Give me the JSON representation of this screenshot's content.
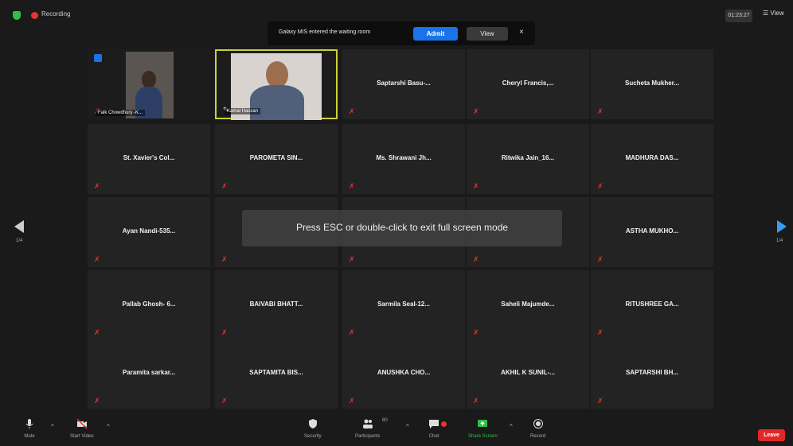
{
  "status": {
    "recording_label": "Recording",
    "timer": "01:23:27",
    "view_label": "View"
  },
  "notice": {
    "text": "Galaxy MIS entered the waiting room",
    "admit_label": "Admit",
    "view_label": "View",
    "close_glyph": "×"
  },
  "toast": {
    "text": "Press ESC or double-click to exit full screen mode"
  },
  "pager": {
    "left": "1/4",
    "right": "1/4"
  },
  "video_tiles": [
    {
      "caption": "Falk Chowdhury -K..."
    },
    {
      "caption": "Kamal Hassan"
    }
  ],
  "participants": [
    "Saptarshi Basu-...",
    "Cheryl Francis,...",
    "Sucheta Mukher...",
    "St. Xavier's Col...",
    "PAROMETA SIN...",
    "Ms. Shrawani Jh...",
    "Ritwika Jain_16...",
    "MADHURA DAS...",
    "Ayan Nandi-535...",
    "ASTHA MUKHO...",
    "Pallab Ghosh- 6...",
    "BAIVABI BHATT...",
    "Sarmila Seal-12...",
    "Saheli Majumde...",
    "RITUSHREE GA...",
    "Paramita sarkar...",
    "SAPTAMITA BIS...",
    "ANUSHKA CHO...",
    "AKHIL K SUNIL-...",
    "SAPTARSHI BH..."
  ],
  "toolbar": {
    "mute": "Mute",
    "start_video": "Start Video",
    "security": "Security",
    "participants": "Participants",
    "participants_count": "80",
    "chat": "Chat",
    "share_screen": "Share Screen",
    "record": "Record",
    "leave": "Leave"
  },
  "colors": {
    "accent": "#1a73e8",
    "leave": "#e02828",
    "active_border": "#c8d23a",
    "share": "#2fbf4a",
    "muted": "#e3342f"
  }
}
